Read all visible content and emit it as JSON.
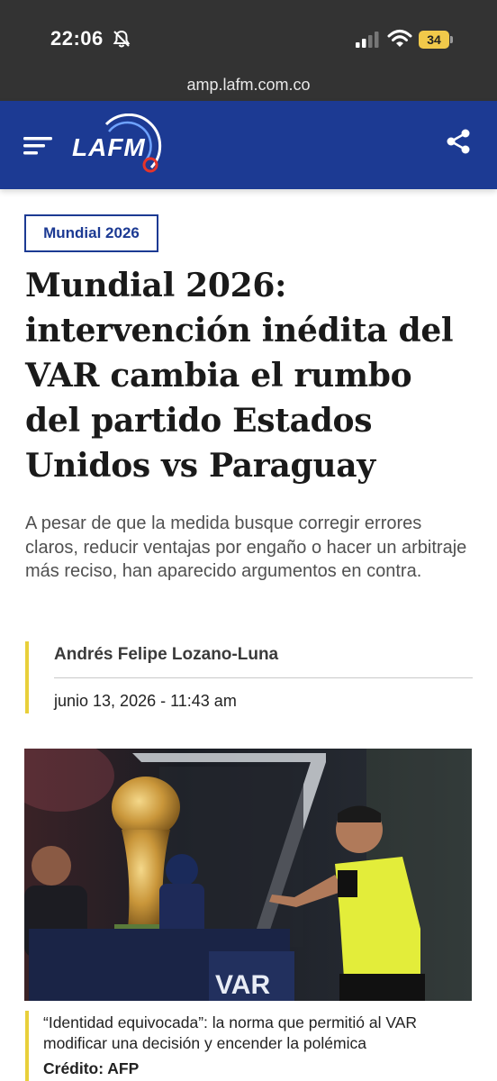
{
  "status_bar": {
    "time": "22:06",
    "battery": "34"
  },
  "browser": {
    "url": "amp.lafm.com.co"
  },
  "header": {
    "logo_text": "LAFM",
    "brand_color": "#1c3a93",
    "menu_icon": "hamburger-menu-icon",
    "share_icon": "share-icon"
  },
  "article": {
    "category": "Mundial 2026",
    "title": "Mundial 2026: intervención inédita del VAR cambia el rumbo del partido Estados Unidos vs Paraguay",
    "summary": "A pesar de que la medida busque corregir errores claros, reducir ventajas por engaño o hacer un arbitraje más reciso, han aparecido argumentos en contra.",
    "author": "Andrés Felipe Lozano-Luna",
    "date": "junio 13, 2026 - 11:43 am",
    "accent_color": "#e8cf3a",
    "image": {
      "sign_text": "VAR"
    },
    "caption": "“Identidad equivocada”: la norma que permitió al VAR modificar una decisión y encender la polémica",
    "credit": "Crédito: AFP"
  }
}
